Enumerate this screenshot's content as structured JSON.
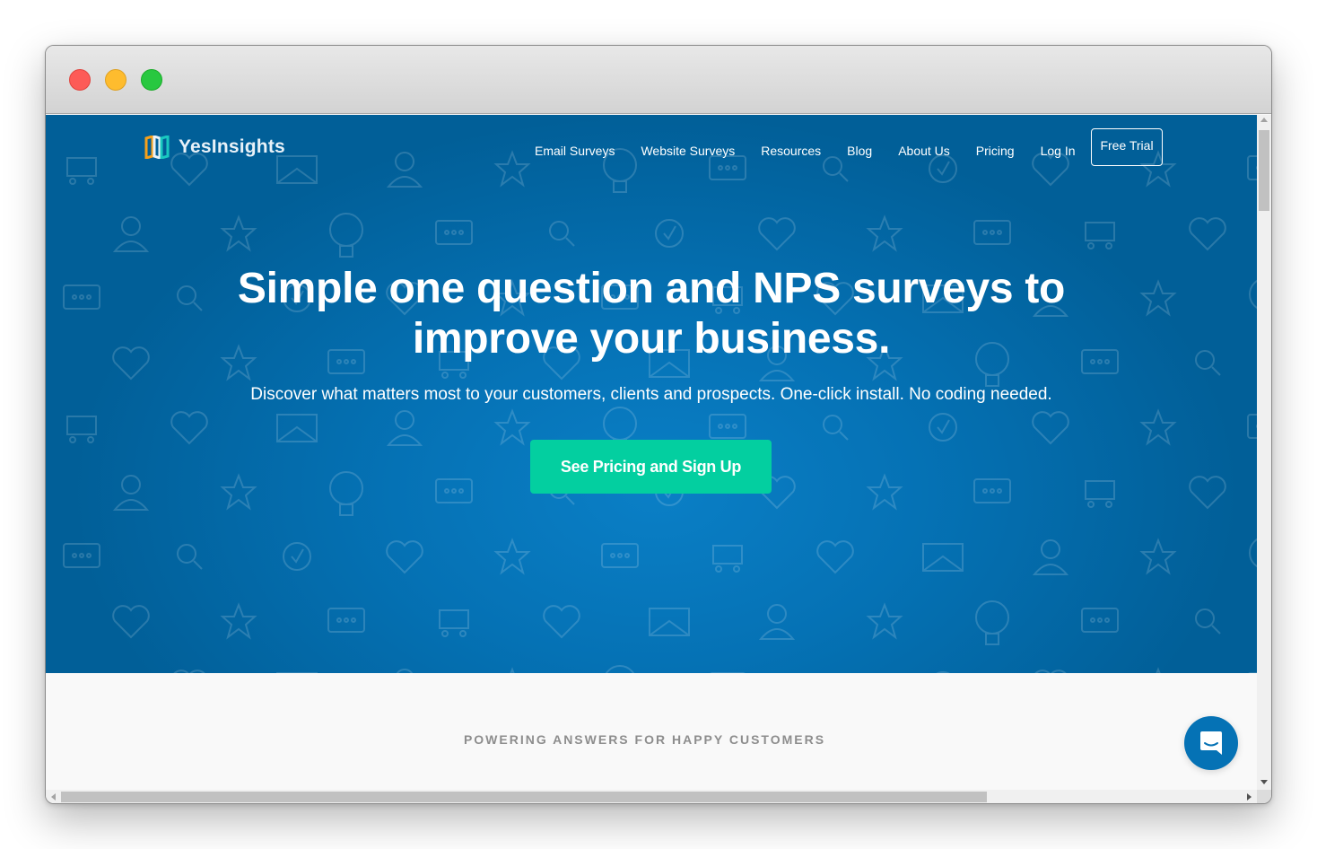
{
  "window": {
    "controls": [
      "close",
      "minimize",
      "maximize"
    ]
  },
  "header": {
    "logo_text": "YesInsights",
    "nav": [
      {
        "label": "Email Surveys"
      },
      {
        "label": "Website Surveys"
      },
      {
        "label": "Resources"
      },
      {
        "label": "Blog"
      },
      {
        "label": "About Us"
      },
      {
        "label": "Pricing"
      },
      {
        "label": "Log In"
      }
    ],
    "cta_label": "Free Trial"
  },
  "hero": {
    "headline_line1": "Simple one question and NPS surveys to",
    "headline_line2": "improve your business.",
    "subheadline": "Discover what matters most to your customers, clients and prospects. One-click install. No coding needed.",
    "cta_label": "See Pricing and Sign Up"
  },
  "section": {
    "powering_label": "POWERING ANSWERS FOR HAPPY CUSTOMERS"
  },
  "colors": {
    "hero_blue": "#0572b5",
    "cta_green": "#03cfa0",
    "logo_orange": "#f6a01a",
    "logo_teal": "#19c8c0"
  },
  "icons": {
    "chat": "chat-bubble-smile-icon"
  }
}
